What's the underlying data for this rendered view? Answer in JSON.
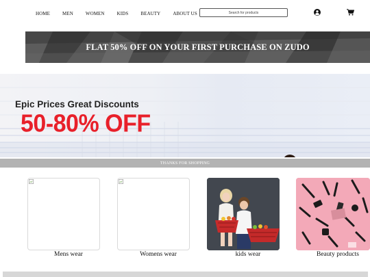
{
  "nav": {
    "links": [
      "HOME",
      "MEN",
      "WOMEN",
      "KIDS",
      "BEAUTY",
      "ABOUT US"
    ],
    "search_placeholder": "Search for products",
    "user_icon": "user-circle-icon",
    "cart_icon": "cart-icon"
  },
  "promo": {
    "text": "FLAT 50% OFF ON YOUR FIRST PURCHASE ON ZUDO"
  },
  "hero": {
    "title": "Epic Prices Great Discounts",
    "offer": "50-80% OFF",
    "offer_color": "#e8202a"
  },
  "thanks": {
    "text": "THANKS FOR SHOPPING"
  },
  "categories": [
    {
      "label": "Mens wear",
      "image": "broken-image-icon"
    },
    {
      "label": "Womens wear",
      "image": "broken-image-icon"
    },
    {
      "label": "kids wear",
      "image": "kids-photo"
    },
    {
      "label": "Beauty products",
      "image": "cosmetics-photo"
    }
  ]
}
